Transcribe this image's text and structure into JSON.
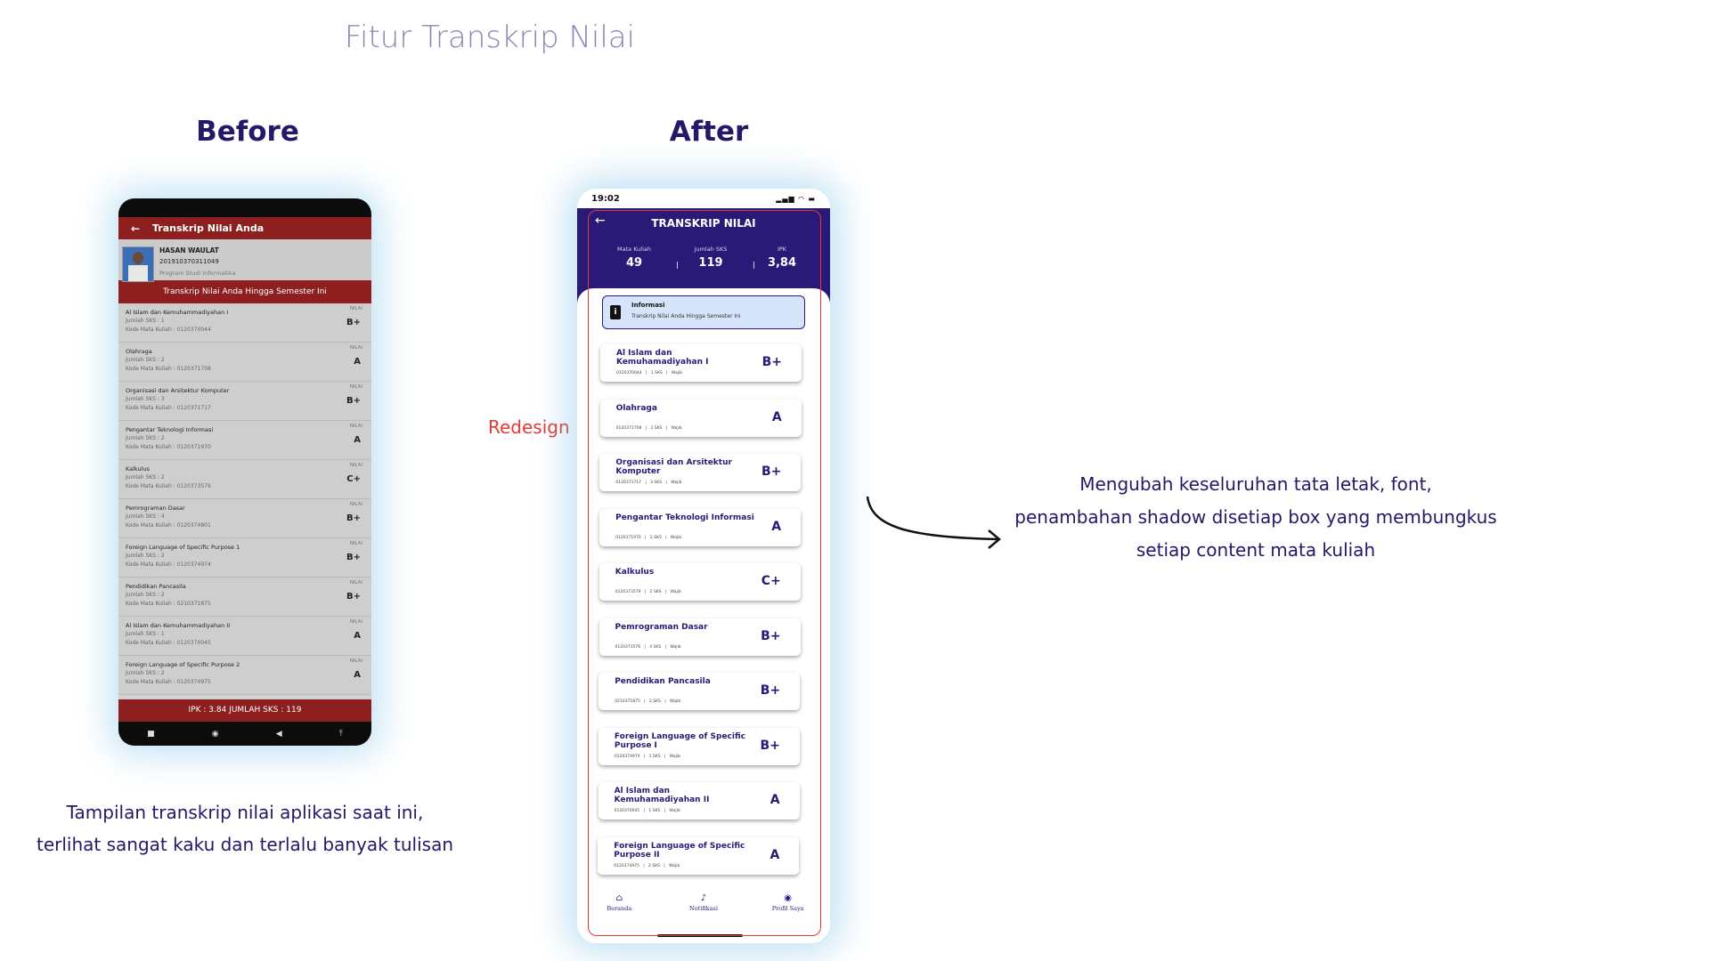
{
  "page_title": "Fitur Transkrip Nilai",
  "before_title": "Before",
  "after_title": "After",
  "redesign_label": "Redesign",
  "description": [
    "Mengubah keseluruhan tata letak, font,",
    "penambahan shadow disetiap box yang membungkus",
    "setiap content mata kuliah"
  ],
  "before_caption": [
    "Tampilan transkrip nilai aplikasi saat ini,",
    "terlihat sangat kaku dan terlalu banyak tulisan"
  ],
  "old_app": {
    "back_icon": "←",
    "title": "Transkrip Nilai Anda",
    "student_name": "HASAN WAULAT",
    "student_id": "201910370311049",
    "study_program": "Program Studi Informatika",
    "banner": "Transkrip Nilai Anda Hingga Semester Ini",
    "grade_label": "NILAI",
    "courses": [
      {
        "name": "Al Islam dan Kemuhammadiyahan I",
        "sks": "Jumlah SKS : 1",
        "code": "Kode Mata Kuliah : 0120370044",
        "grade": "B+"
      },
      {
        "name": "Olahraga",
        "sks": "Jumlah SKS : 2",
        "code": "Kode Mata Kuliah : 0120371708",
        "grade": "A"
      },
      {
        "name": "Organisasi dan Arsitektur Komputer",
        "sks": "Jumlah SKS : 3",
        "code": "Kode Mata Kuliah : 0120371717",
        "grade": "B+"
      },
      {
        "name": "Pengantar Teknologi Informasi",
        "sks": "Jumlah SKS : 2",
        "code": "Kode Mata Kuliah : 0120371970",
        "grade": "A"
      },
      {
        "name": "Kalkulus",
        "sks": "Jumlah SKS : 2",
        "code": "Kode Mata Kuliah : 0120373579",
        "grade": "C+"
      },
      {
        "name": "Pemrograman Dasar",
        "sks": "Jumlah SKS : 4",
        "code": "Kode Mata Kuliah : 0120374801",
        "grade": "B+"
      },
      {
        "name": "Foreign Language of Specific Purpose 1",
        "sks": "Jumlah SKS : 2",
        "code": "Kode Mata Kuliah : 0120374974",
        "grade": "B+"
      },
      {
        "name": "Pendidikan Pancasila",
        "sks": "Jumlah SKS : 2",
        "code": "Kode Mata Kuliah : 0210371875",
        "grade": "B+"
      },
      {
        "name": "Al Islam dan Kemuhammadiyahan II",
        "sks": "Jumlah SKS : 1",
        "code": "Kode Mata Kuliah : 0120370045",
        "grade": "A"
      },
      {
        "name": "Foreign Language of Specific Purpose 2",
        "sks": "Jumlah SKS : 2",
        "code": "Kode Mata Kuliah : 0120374975",
        "grade": "A"
      }
    ],
    "footer": "IPK : 3.84 JUMLAH SKS : 119",
    "nav_icons": [
      "■",
      "◉",
      "◀",
      "⤒"
    ]
  },
  "new_app": {
    "time": "19:02",
    "status_icons": "▂▄▆ ◠ ▬",
    "back_icon": "←",
    "title": "TRANSKRIP NILAI",
    "stats": [
      {
        "label": "Mata Kuliah",
        "value": "49"
      },
      {
        "label": "Jumlah SKS",
        "value": "119"
      },
      {
        "label": "IPK",
        "value": "3,84"
      }
    ],
    "info": {
      "icon": "i",
      "title": "Informasi",
      "text": "Transkrip Nilai Anda Hingga Semester Ini"
    },
    "courses": [
      {
        "name": "Al Islam dan Kemuhamadiyahan I",
        "code": "0120370044",
        "sks": "1 SKS",
        "type": "Wajib",
        "grade": "B+"
      },
      {
        "name": "Olahraga",
        "code": "0120371708",
        "sks": "2 SKS",
        "type": "Wajib",
        "grade": "A"
      },
      {
        "name": "Organisasi dan Arsitektur Komputer",
        "code": "0120371717",
        "sks": "3 SKS",
        "type": "Wajib",
        "grade": "B+"
      },
      {
        "name": "Pengantar Teknologi Informasi",
        "code": "0120371970",
        "sks": "2 SKS",
        "type": "Wajib",
        "grade": "A"
      },
      {
        "name": "Kalkulus",
        "code": "0120373579",
        "sks": "2 SKS",
        "type": "Wajib",
        "grade": "C+"
      },
      {
        "name": "Pemrograman Dasar",
        "code": "0120373576",
        "sks": "4 SKS",
        "type": "Wajib",
        "grade": "B+"
      },
      {
        "name": "Pendidikan Pancasila",
        "code": "0210371875",
        "sks": "2 SKS",
        "type": "Wajib",
        "grade": "B+"
      },
      {
        "name": "Foreign Language of Specific Purpose I",
        "code": "0120374974",
        "sks": "1 SKS",
        "type": "Wajib",
        "grade": "B+"
      },
      {
        "name": "Al Islam dan Kemuhamadiyahan II",
        "code": "0120370045",
        "sks": "1 SKS",
        "type": "Wajib",
        "grade": "A"
      },
      {
        "name": "Foreign Language of Specific Purpose II",
        "code": "0120374975",
        "sks": "2 SKS",
        "type": "Wajib",
        "grade": "A"
      }
    ],
    "nav": [
      {
        "icon": "⌂",
        "label": "Beranda"
      },
      {
        "icon": "♪",
        "label": "Notifikasi"
      },
      {
        "icon": "◉",
        "label": "Profil Saya"
      }
    ]
  }
}
